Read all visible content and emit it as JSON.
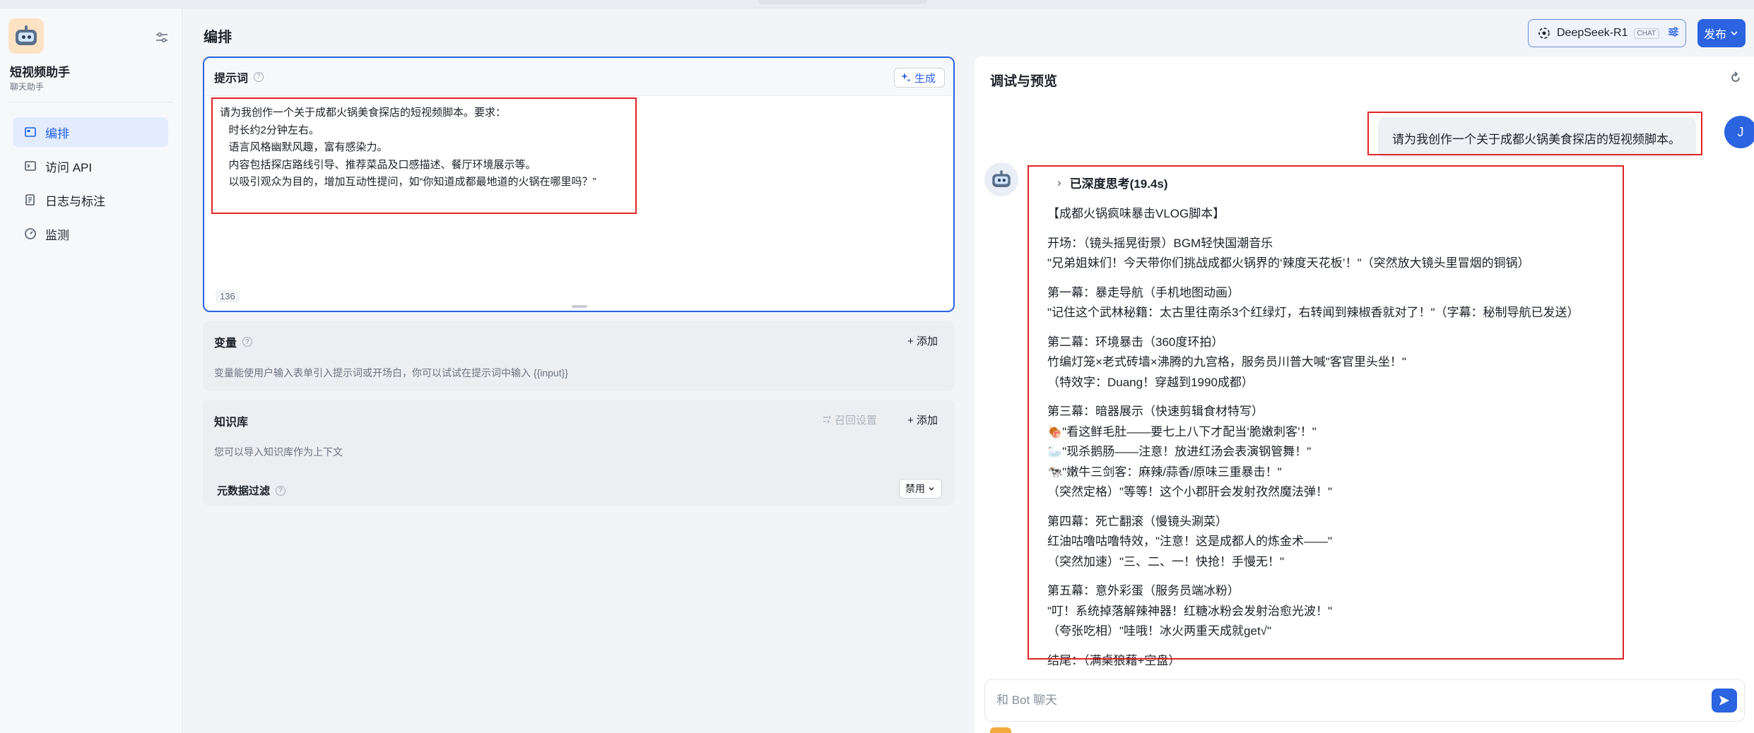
{
  "app": {
    "name": "短视频助手",
    "subtitle": "聊天助手"
  },
  "nav": [
    {
      "label": "编排",
      "icon": "layout-icon",
      "active": true
    },
    {
      "label": "访问 API",
      "icon": "terminal-icon",
      "active": false
    },
    {
      "label": "日志与标注",
      "icon": "log-icon",
      "active": false
    },
    {
      "label": "监测",
      "icon": "gauge-icon",
      "active": false
    }
  ],
  "header": {
    "title": "编排",
    "model_name": "DeepSeek-R1",
    "model_tag": "CHAT",
    "publish_label": "发布"
  },
  "prompt": {
    "label": "提示词",
    "generate_label": "生成",
    "text": "请为我创作一个关于成都火锅美食探店的短视频脚本。要求：\n   时长约2分钟左右。\n   语言风格幽默风趣，富有感染力。\n   内容包括探店路线引导、推荐菜品及口感描述、餐厅环境展示等。\n   以吸引观众为目的，增加互动性提问，如“你知道成都最地道的火锅在哪里吗？”",
    "char_count": "136"
  },
  "variables": {
    "label": "变量",
    "add_label": "+ 添加",
    "description": "变量能使用户输入表单引入提示词或开场白，你可以试试在提示词中输入 {{input}}"
  },
  "knowledge": {
    "label": "知识库",
    "recall_label": "召回设置",
    "add_label": "+ 添加",
    "description": "您可以导入知识库作为上下文",
    "metadata_label": "元数据过滤",
    "metadata_value": "禁用"
  },
  "preview": {
    "title": "调试与预览",
    "user_avatar": "J",
    "user_message": "请为我创作一个关于成都火锅美食探店的短视频脚本。",
    "thinking_label": "已深度思考(19.4s)",
    "answer_paragraphs": [
      [
        "【成都火锅疯味暴击VLOG脚本】"
      ],
      [
        "开场：（镜头摇晃街景）BGM轻快国潮音乐",
        "\"兄弟姐妹们！今天带你们挑战成都火锅界的‘辣度天花板’！\"（突然放大镜头里冒烟的铜锅）"
      ],
      [
        "第一幕：暴走导航（手机地图动画）",
        "\"记住这个武林秘籍：太古里往南杀3个红绿灯，右转闻到辣椒香就对了！\"（字幕：秘制导航已发送）"
      ],
      [
        "第二幕：环境暴击（360度环拍）",
        "竹编灯笼×老式砖墙×沸腾的九宫格，服务员川普大喊\"客官里头坐！\"",
        "（特效字：Duang！穿越到1990成都）"
      ],
      [
        "第三幕：暗器展示（快速剪辑食材特写）",
        "🍖\"看这鲜毛肚——要七上八下才配当‘脆嫩刺客’！\"",
        "🦢\"现杀鹅肠——注意！放进红汤会表演钢管舞！\"",
        "🐄\"嫩牛三剑客：麻辣/蒜香/原味三重暴击！\"",
        "（突然定格）\"等等！这个小郡肝会发射孜然魔法弹！\""
      ],
      [
        "第四幕：死亡翻滚（慢镜头涮菜）",
        "红油咕噜咕噜特效，\"注意！这是成都人的炼金术——\"",
        "（突然加速）\"三、二、一！快抢！手慢无！\""
      ],
      [
        "第五幕：意外彩蛋（服务员端冰粉）",
        "\"叮！系统掉落解辣神器！红糖冰粉会发射治愈光波！\"",
        "（夸张吃相）\"哇哦！冰火两重天成就get√\""
      ],
      [
        "结尾：（满桌狼藉+空盘）"
      ]
    ],
    "input_placeholder": "和 Bot 聊天"
  },
  "colors": {
    "accent": "#2b63e0",
    "highlight_box": "#e02424",
    "active_nav_bg": "#e3ecfc"
  }
}
